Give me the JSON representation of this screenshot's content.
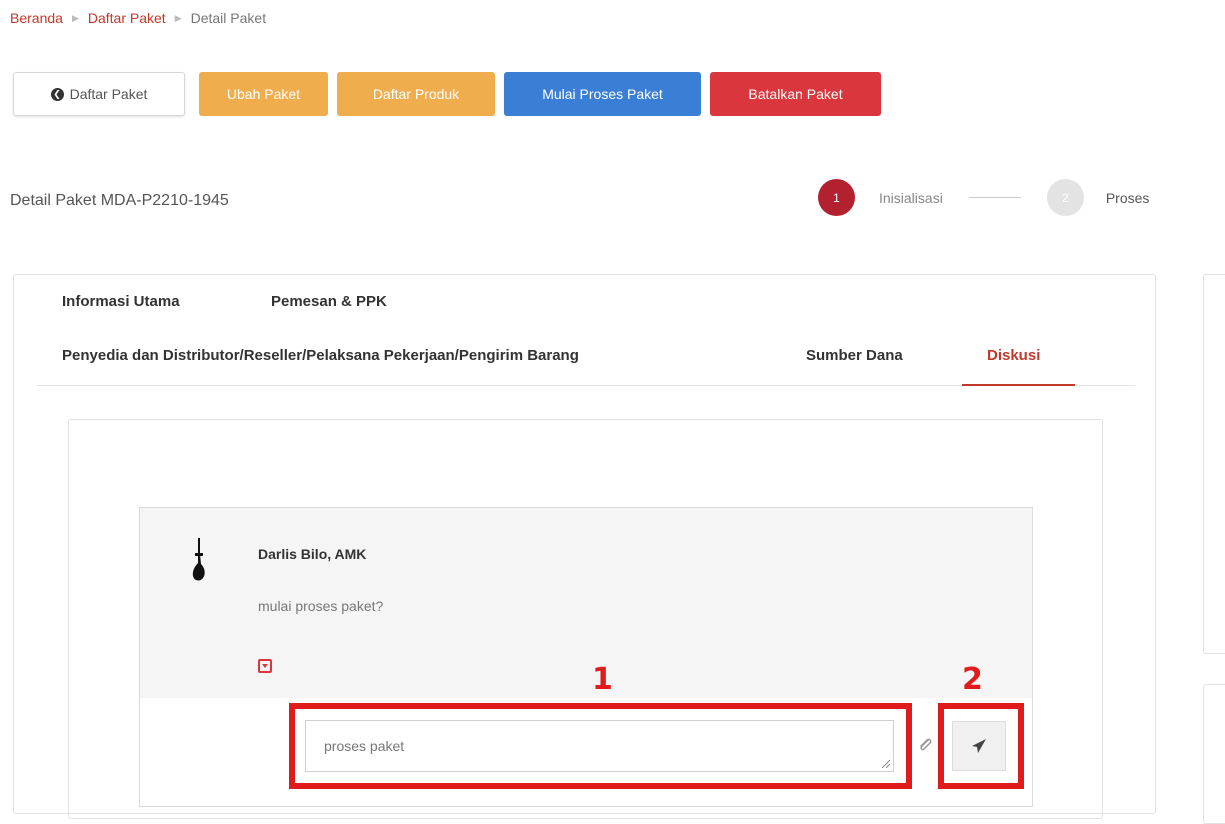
{
  "breadcrumb": {
    "home": "Beranda",
    "list": "Daftar Paket",
    "current": "Detail Paket"
  },
  "actions": {
    "back": "Daftar Paket",
    "edit": "Ubah Paket",
    "products": "Daftar Produk",
    "start": "Mulai Proses Paket",
    "cancel": "Batalkan Paket"
  },
  "detail_title": "Detail Paket MDA-P2210-1945",
  "stepper": {
    "step1_number": "1",
    "step1_label": "Inisialisasi",
    "step2_number": "2",
    "step2_label": "Proses"
  },
  "tabs": {
    "main_info": "Informasi Utama",
    "orderer": "Pemesan & PPK",
    "provider": "Penyedia dan Distributor/Reseller/Pelaksana Pekerjaan/Pengirim Barang",
    "funding": "Sumber Dana",
    "discussion": "Diskusi"
  },
  "comment": {
    "author": "Darlis Bilo, AMK",
    "text": "mulai proses paket?"
  },
  "reply": {
    "value": "proses paket"
  },
  "annotations": {
    "label1": "1",
    "label2": "2"
  },
  "colors": {
    "accent_red": "#c0392b",
    "orange": "#f0ad4e",
    "blue": "#3a7fd5",
    "danger": "#d9373d",
    "annotation": "#e01b1b"
  }
}
